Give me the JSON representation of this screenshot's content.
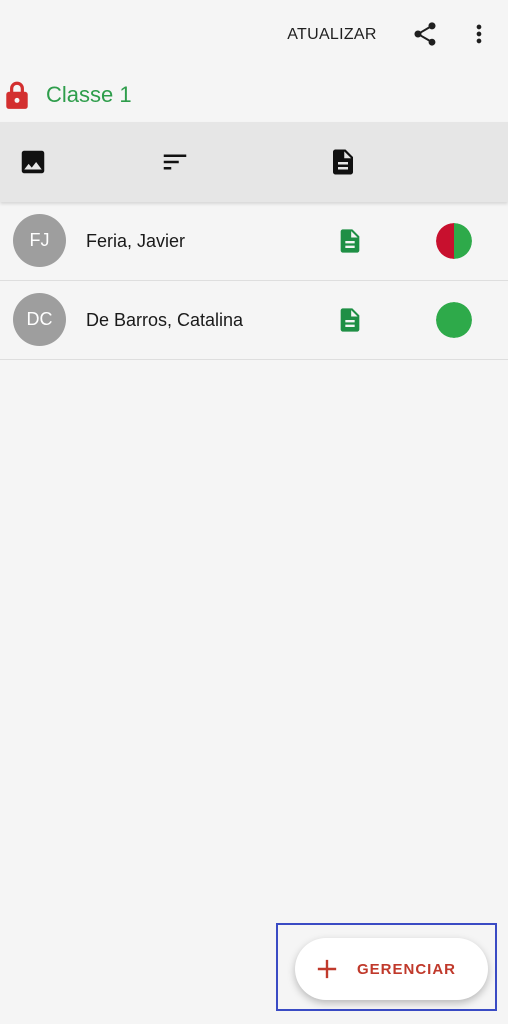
{
  "appbar": {
    "refresh_label": "ATUALIZAR",
    "share_icon": "share-icon",
    "more_icon": "more-vert-icon"
  },
  "class_header": {
    "title": "Classe 1",
    "lock_icon": "lock-icon",
    "lock_color": "#d32f2f",
    "title_color": "#2e9d4b"
  },
  "toolbar": {
    "icons": [
      "image-icon",
      "sort-icon",
      "document-icon"
    ]
  },
  "students": [
    {
      "initials": "FJ",
      "name": "Feria, Javier",
      "doc_icon": "document-icon",
      "status": "partial",
      "status_colors": [
        "#c8102e",
        "#2eaa4a"
      ]
    },
    {
      "initials": "DC",
      "name": "De Barros, Catalina",
      "doc_icon": "document-icon",
      "status": "complete",
      "status_colors": [
        "#2eaa4a"
      ]
    }
  ],
  "fab": {
    "label": "GERENCIAR",
    "icon": "plus-icon",
    "color": "#c0392b"
  }
}
